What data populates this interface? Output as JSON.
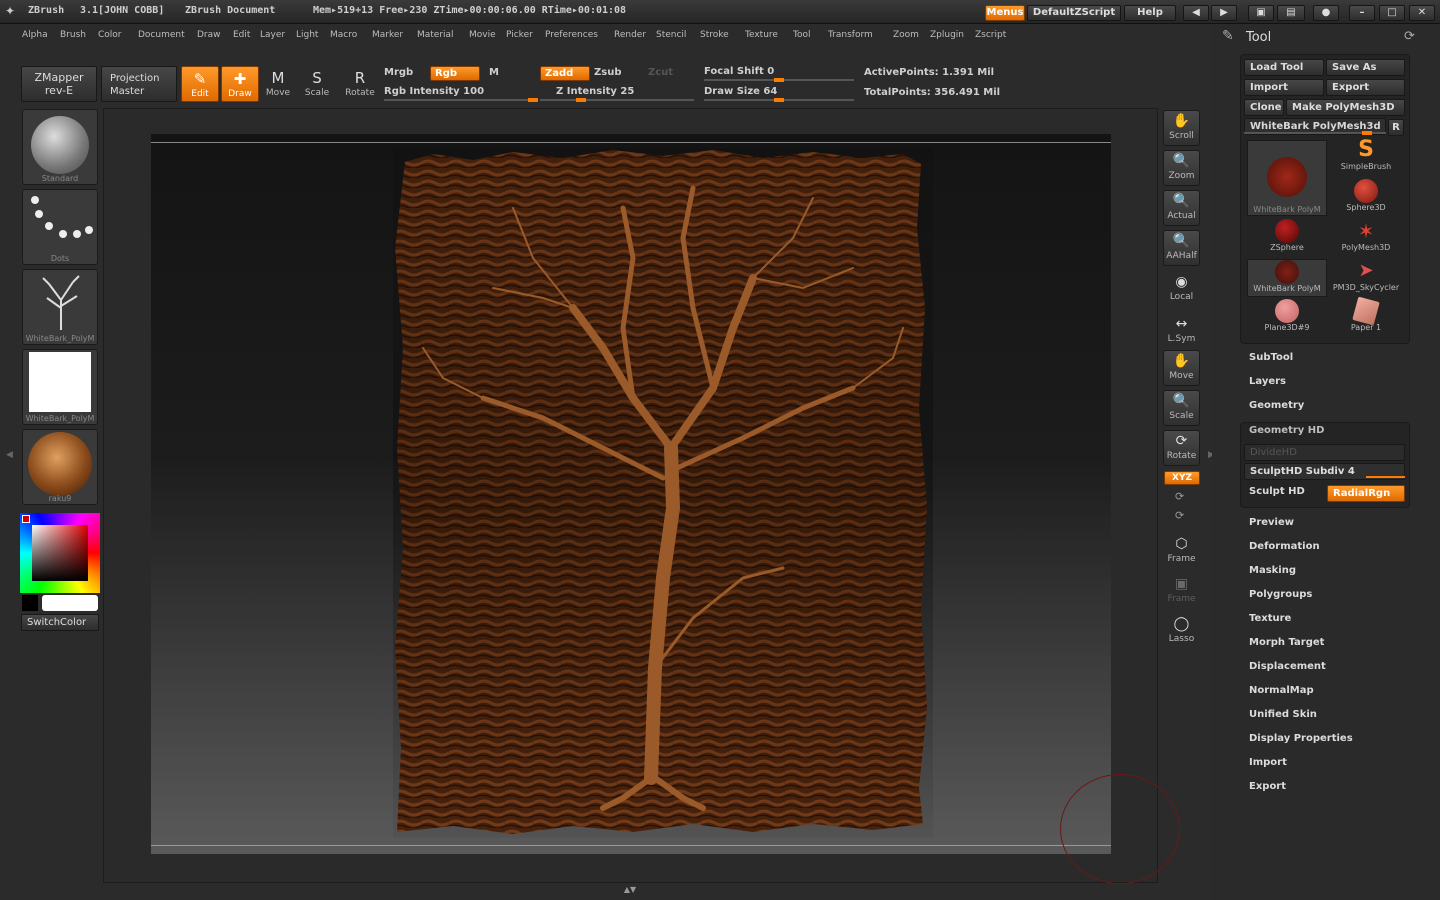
{
  "titlebar": {
    "app": "ZBrush",
    "version": "3.1[JOHN COBB]",
    "doc": "ZBrush Document",
    "mem": "Mem▸519+13 Free▸230 ZTime▸00:00:06.00 RTime▸00:01:08",
    "menus_btn": "Menus",
    "script_btn": "DefaultZScript",
    "help_btn": "Help"
  },
  "menubar": [
    "Alpha",
    "Brush",
    "Color",
    "Document",
    "Draw",
    "Edit",
    "Layer",
    "Light",
    "Macro",
    "Marker",
    "Material",
    "Movie",
    "Picker",
    "Preferences",
    "Render",
    "Stencil",
    "Stroke",
    "Texture",
    "Tool",
    "Transform",
    "Zoom",
    "Zplugin",
    "Zscript"
  ],
  "toolbar": {
    "zmapper_1": "ZMapper",
    "zmapper_2": "rev-E",
    "projection_1": "Projection",
    "projection_2": "Master",
    "edit": "Edit",
    "draw": "Draw",
    "move": "Move",
    "scale": "Scale",
    "rotate": "Rotate",
    "mrgb": "Mrgb",
    "rgb": "Rgb",
    "m": "M",
    "rgb_intensity": "Rgb Intensity 100",
    "zadd": "Zadd",
    "zsub": "Zsub",
    "zcut": "Zcut",
    "z_intensity": "Z Intensity 25",
    "focal_shift": "Focal Shift 0",
    "draw_size": "Draw Size 64",
    "active_points": "ActivePoints: 1.391  Mil",
    "total_points": "TotalPoints: 356.491  Mil",
    "rgb_intensity_level": 1.0,
    "z_intensity_level": 0.25,
    "focal_shift_level": 0.5,
    "draw_size_level": 0.5
  },
  "left": {
    "thumbs": [
      "Standard",
      "Dots",
      "WhiteBark_PolyM",
      "WhiteBark_PolyM",
      "raku9"
    ],
    "switch_color": "SwitchColor"
  },
  "right_shelf": [
    "Scroll",
    "Zoom",
    "Actual",
    "AAHalf",
    "Local",
    "L.Sym",
    "Move",
    "Scale",
    "Rotate",
    "XYZ",
    "Frame",
    "Frame",
    "Lasso"
  ],
  "tool_panel": {
    "title": "Tool",
    "load": "Load Tool",
    "save": "Save As",
    "import": "Import",
    "export": "Export",
    "clone": "Clone",
    "make": "Make PolyMesh3D",
    "current": "WhiteBark PolyMesh3d",
    "r": "R",
    "tools": [
      "WhiteBark PolyM",
      "SimpleBrush",
      "Sphere3D",
      "ZSphere",
      "PolyMesh3D",
      "WhiteBark PolyM",
      "PM3D_SkyCycler",
      "Plane3D#9",
      "Paper 1"
    ],
    "sections_a": [
      "SubTool",
      "Layers",
      "Geometry"
    ],
    "geometry_hd": "Geometry HD",
    "dividehd": "DivideHD",
    "sculpthd_subdiv": "SculptHD Subdiv 4",
    "sculpt_hd": "Sculpt HD",
    "radialrgn": "RadialRgn",
    "sections_b": [
      "Preview",
      "Deformation",
      "Masking",
      "Polygroups",
      "Texture",
      "Morph Target",
      "Displacement",
      "NormalMap",
      "Unified Skin",
      "Display Properties",
      "Import",
      "Export"
    ]
  },
  "colors": {
    "accent": "#ff8a1a",
    "wood": "#7a3e1a",
    "bg": "#2b2b2b"
  }
}
